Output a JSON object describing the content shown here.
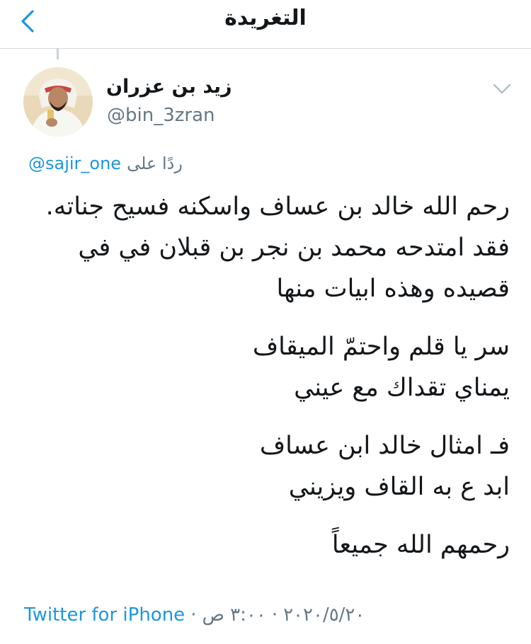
{
  "header": {
    "title": "التغريدة",
    "back_icon": "chevron-left-icon"
  },
  "colors": {
    "accent": "#1d96e0",
    "secondary_text": "#657786",
    "divider": "#d4d9de"
  },
  "author": {
    "name": "زيد بن عزران",
    "handle": "@bin_3zran"
  },
  "reply": {
    "prefix": "ردًا على",
    "mention": "@sajir_one"
  },
  "tweet": {
    "lines": [
      "رحم الله خالد بن عساف واسكنه فسيح جناته.",
      "فقد امتدحه محمد بن نجر بن قبلان في في",
      "قصيده  وهذه ابيات منها",
      "سر يا قلم واحتمّ الميقاف",
      "يمناي تقداك مع عيني",
      "فـ امثال خالد ابن عساف",
      "ابد ع به القاف ويزيني",
      "رحمهم الله جميعاً"
    ]
  },
  "footer": {
    "source": "Twitter for iPhone",
    "separator": "·",
    "date": "٢٠٢٠/٥/٢٠",
    "time": "٣:٠٠ ص"
  }
}
